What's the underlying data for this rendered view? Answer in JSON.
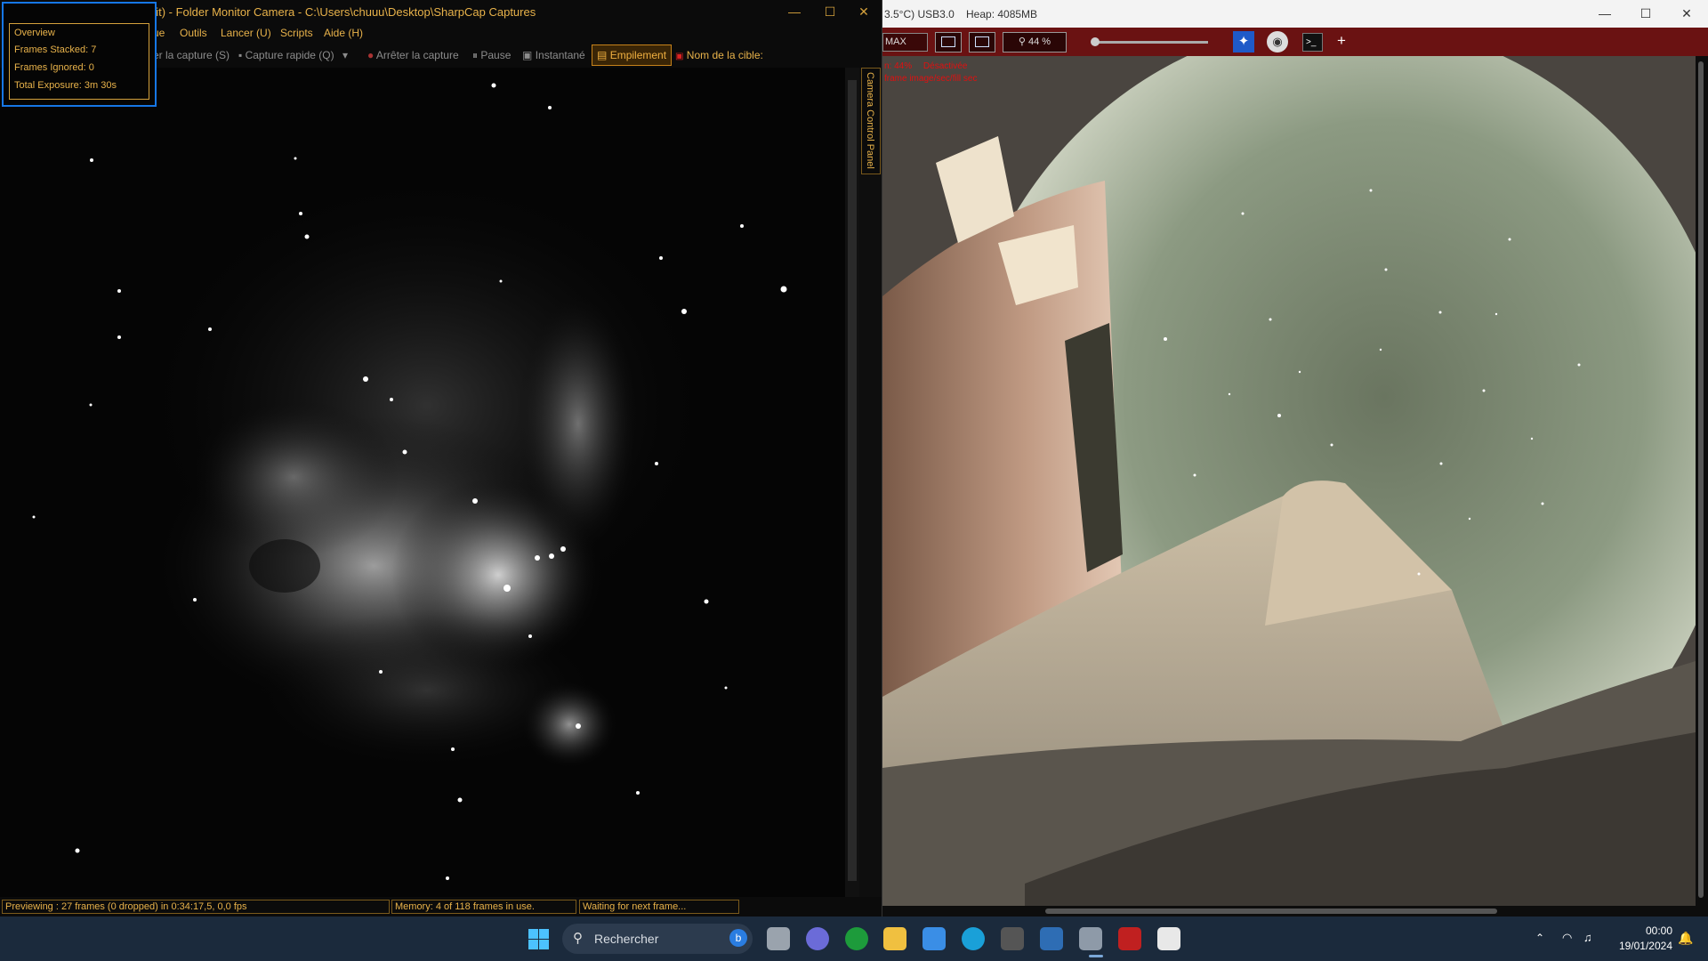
{
  "left_window": {
    "title": "bit) - Folder Monitor Camera - C:\\Users\\chuuu\\Desktop\\SharpCap Captures",
    "menu": [
      "ue",
      "Outils",
      "Lancer (U)",
      "Scripts",
      "Aide (H)"
    ],
    "toolbar": {
      "start_capture": "er la capture (S)",
      "quick_capture": "Capture rapide (Q)",
      "stop_capture": "Arrêter la capture",
      "pause": "Pause",
      "snapshot": "Instantané",
      "stacking": "Empilement",
      "target_name": "Nom de la cible:"
    },
    "side_tab": "Camera Control Panel",
    "status": {
      "previewing": "Previewing : 27 frames (0 dropped) in 0:34:17,5, 0,0 fps",
      "memory": "Memory: 4 of 118 frames in use.",
      "waiting": "Waiting for next frame..."
    }
  },
  "overview": {
    "title": "Overview",
    "frames_stacked": "Frames Stacked: 7",
    "frames_ignored": "Frames Ignored: 0",
    "total_exposure": "Total Exposure:   3m 30s"
  },
  "right_window": {
    "title_sensor": "3.5°C) USB3.0",
    "title_heap": "Heap: 4085MB",
    "toolbar": {
      "max_label": "MAX",
      "zoom": "44 %"
    },
    "overlay": {
      "line1_a": "n: 44%",
      "line1_b": "Désactivée",
      "line2": "frame image/sec/fill sec"
    }
  },
  "taskbar": {
    "search_placeholder": "Rechercher",
    "time": "00:00",
    "date": "19/01/2024"
  },
  "colors": {
    "sharpcap_accent": "#e8b24a",
    "right_toolbar": "#6a1212",
    "taskbar": "#1b2a3c",
    "overview_border": "#1677e6"
  }
}
